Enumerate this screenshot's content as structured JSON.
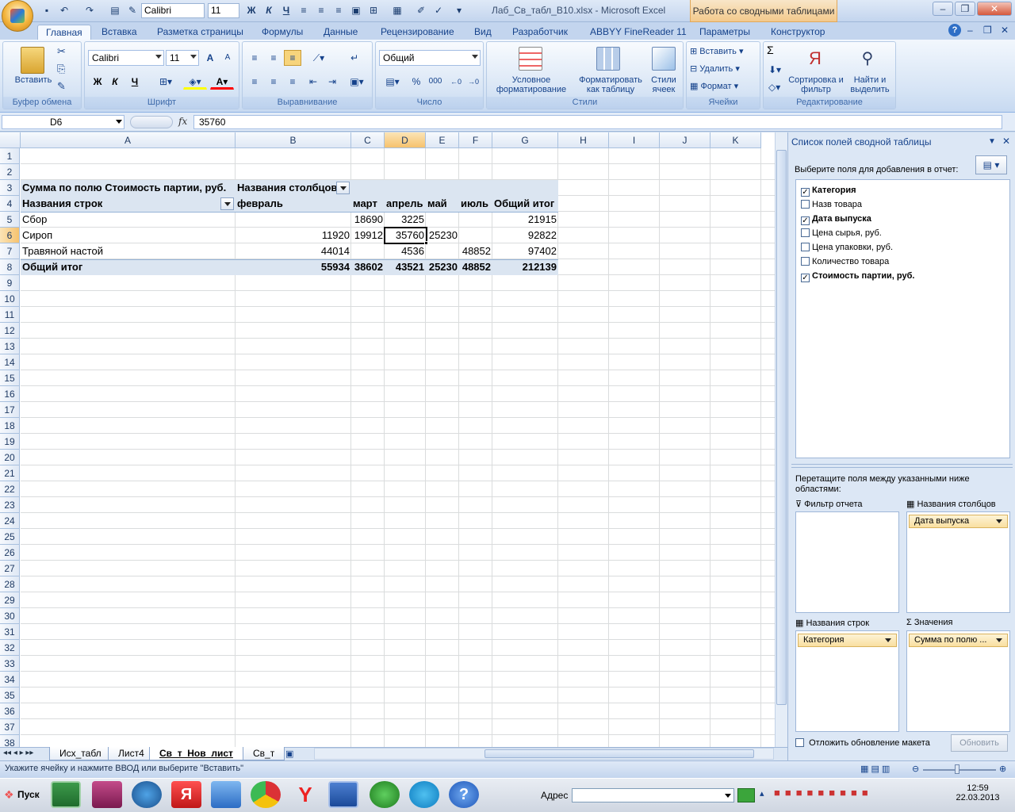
{
  "window": {
    "title": "Лаб_Св_табл_В10.xlsx - Microsoft Excel",
    "context_title": "Работа со сводными таблицами"
  },
  "qat": {
    "font": "Calibri",
    "size": "11"
  },
  "tabs": [
    "Главная",
    "Вставка",
    "Разметка страницы",
    "Формулы",
    "Данные",
    "Рецензирование",
    "Вид",
    "Разработчик",
    "ABBYY FineReader 11",
    "Параметры",
    "Конструктор"
  ],
  "ribbon": {
    "clipboard": {
      "label": "Буфер обмена",
      "paste": "Вставить"
    },
    "font": {
      "label": "Шрифт",
      "name": "Calibri",
      "size": "11",
      "bold": "Ж",
      "italic": "К",
      "underline": "Ч",
      "grow": "A",
      "shrink": "A"
    },
    "alignment": {
      "label": "Выравнивание"
    },
    "number": {
      "label": "Число",
      "format": "Общий",
      "percent": "%",
      "thousands": "000"
    },
    "styles": {
      "label": "Стили",
      "conditional": "Условное форматирование",
      "as_table": "Форматировать как таблицу",
      "cell_styles": "Стили ячеек"
    },
    "cells": {
      "label": "Ячейки",
      "insert": "Вставить",
      "delete": "Удалить",
      "format": "Формат"
    },
    "editing": {
      "label": "Редактирование",
      "sort": "Сортировка и фильтр",
      "find": "Найти и выделить",
      "sigma": "Σ"
    }
  },
  "formula": {
    "name": "D6",
    "fx": "fx",
    "value": "35760"
  },
  "columns": [
    "A",
    "B",
    "C",
    "D",
    "E",
    "F",
    "G",
    "H",
    "I",
    "J",
    "K"
  ],
  "rows": [
    "1",
    "2",
    "3",
    "4",
    "5",
    "6",
    "7",
    "8",
    "9",
    "10",
    "11",
    "12",
    "13",
    "14",
    "15",
    "16",
    "17",
    "18",
    "19",
    "20",
    "21",
    "22",
    "23",
    "24",
    "25",
    "26",
    "27",
    "28",
    "29",
    "30",
    "31",
    "32",
    "33",
    "34",
    "35",
    "36",
    "37",
    "38"
  ],
  "pivot": {
    "r3": {
      "a": "Сумма по полю  Стоимость партии, руб.",
      "b": "Названия столбцов"
    },
    "r4": {
      "a": "Названия строк",
      "b": "февраль",
      "c": "март",
      "d": "апрель",
      "e": "май",
      "f": "июль",
      "g": "Общий итог"
    },
    "r5": {
      "a": "Сбор",
      "b": "",
      "c": "18690",
      "d": "3225",
      "e": "",
      "f": "",
      "g": "21915"
    },
    "r6": {
      "a": "Сироп",
      "b": "11920",
      "c": "19912",
      "d": "35760",
      "e": "25230",
      "f": "",
      "g": "92822"
    },
    "r7": {
      "a": "Травяной настой",
      "b": "44014",
      "c": "",
      "d": "4536",
      "e": "",
      "f": "48852",
      "g": "97402"
    },
    "r8": {
      "a": "Общий итог",
      "b": "55934",
      "c": "38602",
      "d": "43521",
      "e": "25230",
      "f": "48852",
      "g": "212139"
    }
  },
  "sheet_tabs": [
    "Исх_табл",
    "Лист4",
    "Св_т_Нов_лист",
    "Св_т"
  ],
  "status": "Укажите ячейку и нажмите ВВОД или выберите \"Вставить\"",
  "pane": {
    "title": "Список полей сводной таблицы",
    "choose": "Выберите поля для добавления в отчет:",
    "fields": [
      {
        "name": "Категория",
        "checked": true
      },
      {
        "name": "Назв товара",
        "checked": false
      },
      {
        "name": "Дата выпуска",
        "checked": true
      },
      {
        "name": "Цена сырья, руб.",
        "checked": false
      },
      {
        "name": "Цена упаковки, руб.",
        "checked": false
      },
      {
        "name": "Количество товара",
        "checked": false
      },
      {
        "name": "Стоимость партии, руб.",
        "checked": true
      }
    ],
    "drag_hint": "Перетащите поля между указанными ниже областями:",
    "report_filter": "Фильтр отчета",
    "column_labels": "Названия столбцов",
    "row_labels": "Названия строк",
    "values": "Значения",
    "column_chip": "Дата выпуска",
    "row_chip": "Категория",
    "values_chip": "Сумма по полю ...",
    "defer": "Отложить обновление макета",
    "update": "Обновить"
  },
  "taskbar": {
    "start": "Пуск",
    "address": "Адрес",
    "time": "12:59",
    "date": "22.03.2013"
  }
}
